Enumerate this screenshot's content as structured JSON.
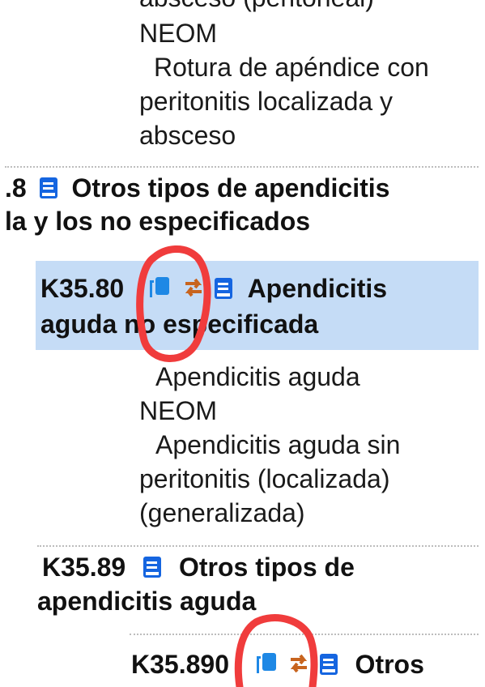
{
  "top_entry": {
    "lines": [
      "absceso (peritoneal)",
      "NEOM",
      "Rotura de apéndice con",
      "peritonitis localizada y",
      "absceso"
    ]
  },
  "k358": {
    "code": ".8",
    "title_line1": "Otros tipos de apendicitis",
    "title_line2": "la y los no especificados"
  },
  "k3580": {
    "code": "K35.80",
    "title_word": "Apendicitis",
    "title_line2": "aguda no especificada",
    "inclusions": [
      "Apendicitis aguda",
      "NEOM",
      "Apendicitis aguda sin",
      "peritonitis (localizada)",
      "(generalizada)"
    ]
  },
  "k3589": {
    "code": "K35.89",
    "title_line1": "Otros tipos de",
    "title_line2": "apendicitis aguda"
  },
  "k35890": {
    "code": "K35.890",
    "title_word": "Otros"
  },
  "colors": {
    "highlight": "#c5dcf6",
    "book_icon": "#1565e0",
    "copy_icon": "#1e88e5",
    "swap_icon": "#c8641e",
    "annotation": "#f03c3c"
  },
  "icons": [
    "book-icon",
    "copy-icon",
    "swap-icon"
  ]
}
